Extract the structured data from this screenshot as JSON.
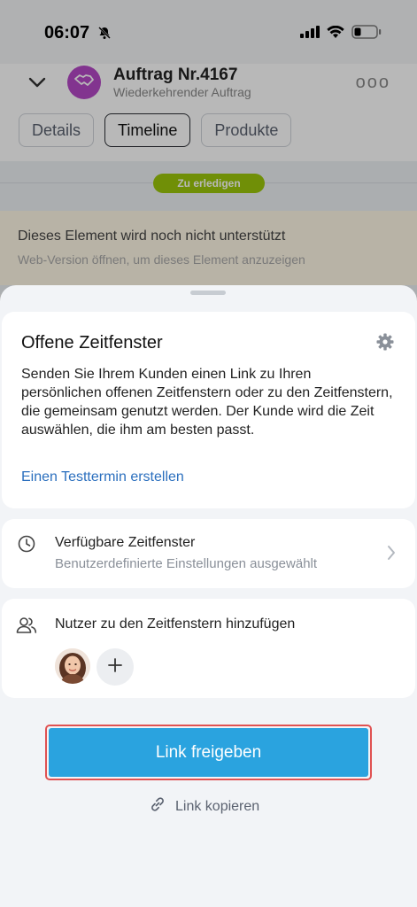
{
  "status_bar": {
    "time": "06:07"
  },
  "header": {
    "title": "Auftrag Nr.4167",
    "subtitle": "Wiederkehrender Auftrag",
    "more_label": "ooo"
  },
  "tabs": [
    {
      "label": "Details"
    },
    {
      "label": "Timeline",
      "active": true
    },
    {
      "label": "Produkte"
    }
  ],
  "timeline": {
    "todo_label": "Zu erledigen",
    "unsupported_title": "Dieses Element wird noch nicht unterstützt",
    "unsupported_hint": "Web-Version öffnen, um dieses Element anzuzeigen"
  },
  "sheet": {
    "open_slots": {
      "title": "Offene Zeitfenster",
      "description": "Senden Sie Ihrem Kunden einen Link zu Ihren persönlichen offenen Zeitfenstern oder zu den Zeitfenstern, die gemeinsam genutzt werden. Der Kunde wird die Zeit auswählen, die ihm am besten passt.",
      "test_link": "Einen Testtermin erstellen"
    },
    "available_slots": {
      "title": "Verfügbare Zeitfenster",
      "subtitle": "Benutzerdefinierte Einstellungen ausgewählt"
    },
    "users": {
      "title": "Nutzer zu den Zeitfenstern hinzufügen"
    },
    "share_button": "Link freigeben",
    "copy_link": "Link kopieren"
  },
  "colors": {
    "accent": "#2aa3df",
    "link": "#2b6fbe",
    "todo_badge": "#9bc70a",
    "highlight": "#e05252",
    "deal_avatar": "#b548c6"
  },
  "icons": [
    "bell-off-icon",
    "signal-icon",
    "wifi-icon",
    "battery-icon",
    "chevron-down-icon",
    "handshake-icon",
    "gear-icon",
    "clock-icon",
    "chevron-right-icon",
    "users-icon",
    "plus-icon",
    "link-icon"
  ]
}
